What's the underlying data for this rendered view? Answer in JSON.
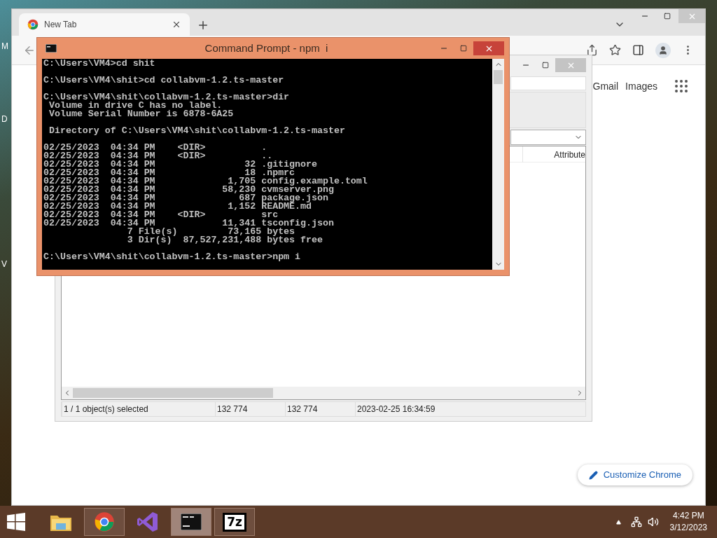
{
  "desktop": {
    "edge_labels": [
      "M",
      "D",
      "V"
    ]
  },
  "browser": {
    "tabs": [
      {
        "title": "New Tab",
        "selected": true
      }
    ],
    "links": [
      "Gmail",
      "Images"
    ],
    "customize_button": "Customize Chrome"
  },
  "file_manager": {
    "columns": [
      "Attribute"
    ],
    "status_bar": [
      "1 / 1 object(s) selected",
      "132 774",
      "132 774",
      "2023-02-25 16:34:59"
    ]
  },
  "console": {
    "title": "Command Prompt - npm  i",
    "blocks": [
      [
        "C:\\Users\\VM4>cd shit"
      ],
      [
        "C:\\Users\\VM4\\shit>cd collabvm-1.2.ts-master"
      ],
      [
        "C:\\Users\\VM4\\shit\\collabvm-1.2.ts-master>dir",
        " Volume in drive C has no label.",
        " Volume Serial Number is 6878-6A25"
      ],
      [
        " Directory of C:\\Users\\VM4\\shit\\collabvm-1.2.ts-master"
      ],
      [
        "02/25/2023  04:34 PM    <DIR>          .",
        "02/25/2023  04:34 PM    <DIR>          ..",
        "02/25/2023  04:34 PM                32 .gitignore",
        "02/25/2023  04:34 PM                18 .npmrc",
        "02/25/2023  04:34 PM             1,705 config.example.toml",
        "02/25/2023  04:34 PM            58,230 cvmserver.png",
        "02/25/2023  04:34 PM               687 package.json",
        "02/25/2023  04:34 PM             1,152 README.md",
        "02/25/2023  04:34 PM    <DIR>          src",
        "02/25/2023  04:34 PM            11,341 tsconfig.json",
        "               7 File(s)         73,165 bytes",
        "               3 Dir(s)  87,527,231,488 bytes free"
      ],
      [
        "C:\\Users\\VM4\\shit\\collabvm-1.2.ts-master>npm i"
      ]
    ]
  },
  "taskbar": {
    "apps": [
      {
        "kind": "folder",
        "running": false,
        "selected": false
      },
      {
        "kind": "chrome",
        "running": true,
        "selected": false
      },
      {
        "kind": "studio",
        "running": false,
        "selected": false
      },
      {
        "kind": "console",
        "running": true,
        "selected": true
      },
      {
        "kind": "archive",
        "running": true,
        "selected": false,
        "label": "7z"
      }
    ],
    "time": "4:42 PM",
    "date": "3/12/2023"
  }
}
